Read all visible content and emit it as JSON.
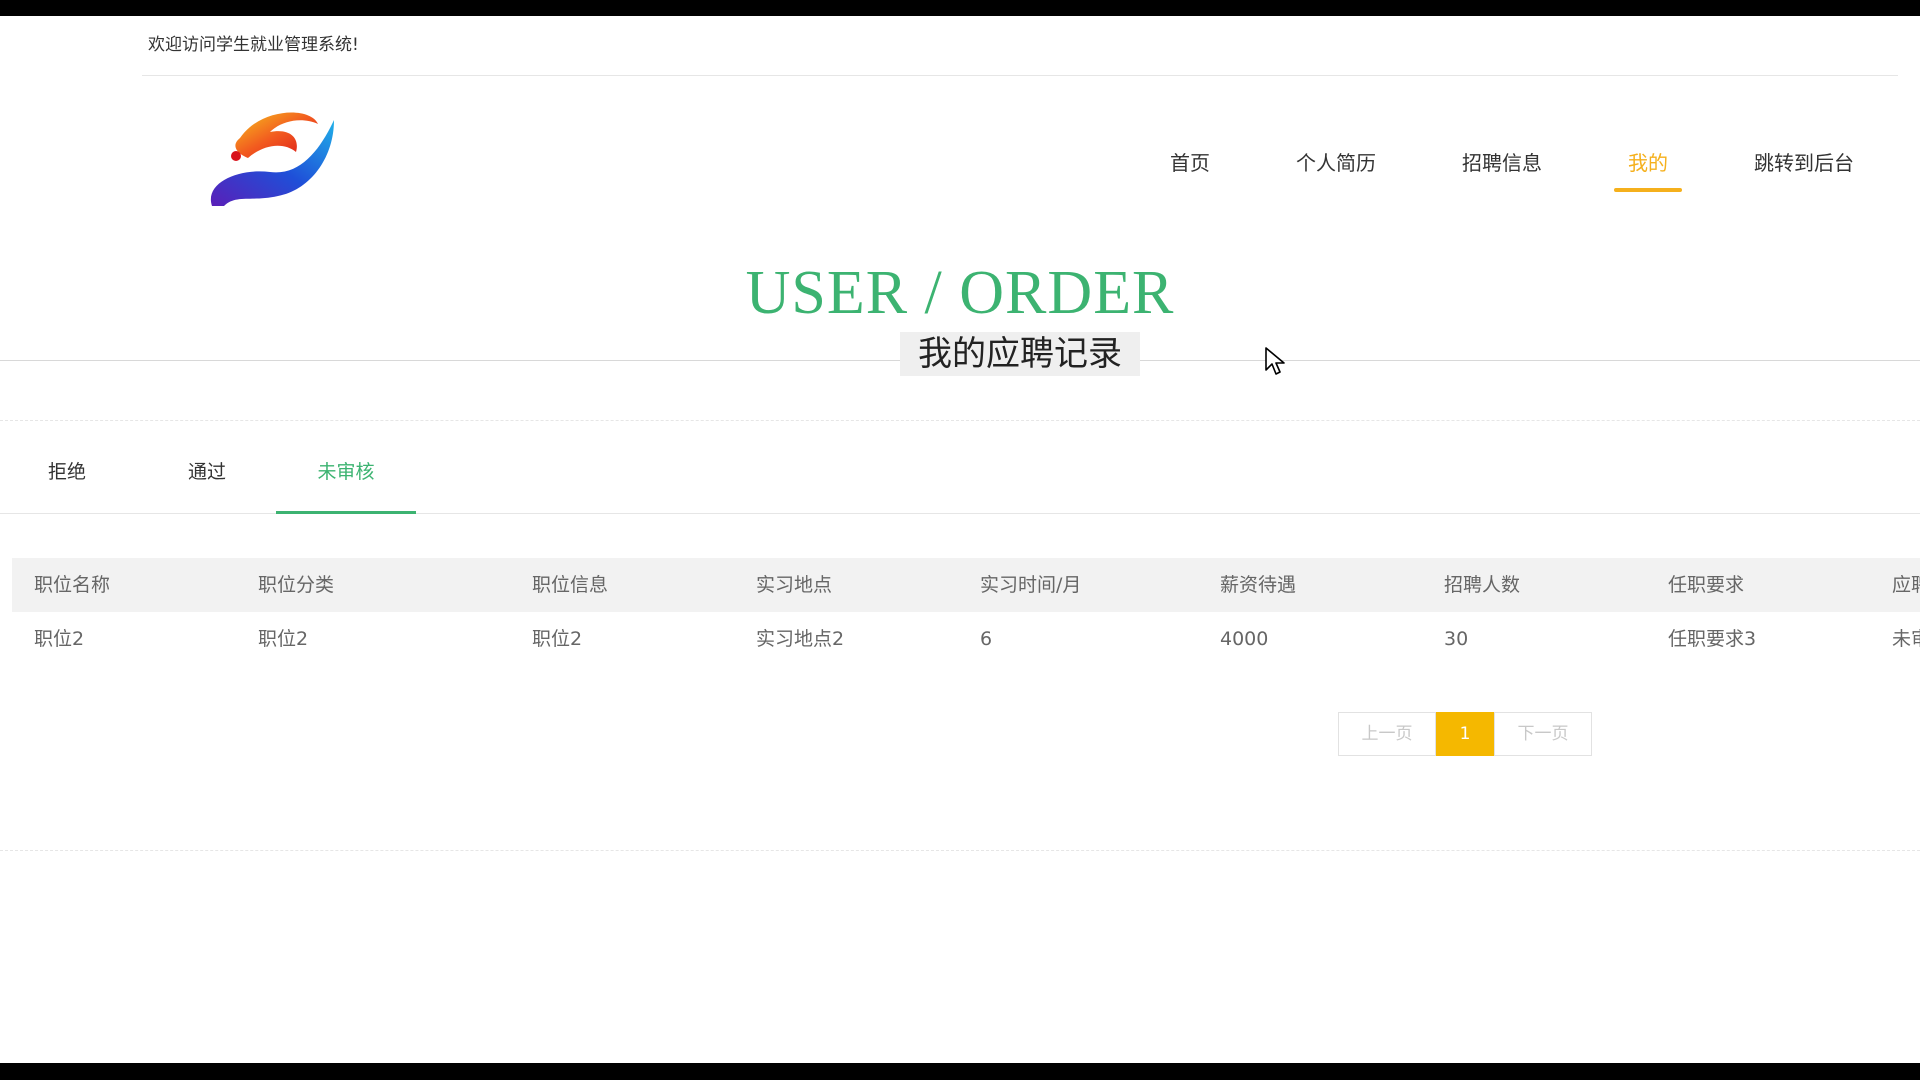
{
  "header": {
    "welcome": "欢迎访问学生就业管理系统!"
  },
  "nav": {
    "items": [
      {
        "label": "首页",
        "active": false
      },
      {
        "label": "个人简历",
        "active": false
      },
      {
        "label": "招聘信息",
        "active": false
      },
      {
        "label": "我的",
        "active": true
      },
      {
        "label": "跳转到后台",
        "active": false
      }
    ]
  },
  "hero": {
    "title": "USER / ORDER",
    "subtitle": "我的应聘记录"
  },
  "tabs": [
    {
      "label": "拒绝",
      "active": false
    },
    {
      "label": "通过",
      "active": false
    },
    {
      "label": "未审核",
      "active": true
    }
  ],
  "table": {
    "columns": [
      "职位名称",
      "职位分类",
      "职位信息",
      "实习地点",
      "实习时间/月",
      "薪资待遇",
      "招聘人数",
      "任职要求",
      "应聘状态"
    ],
    "rows": [
      [
        "职位2",
        "职位2",
        "职位2",
        "实习地点2",
        "6",
        "4000",
        "30",
        "任职要求3",
        "未审核"
      ]
    ]
  },
  "pagination": {
    "prev": "上一页",
    "current": "1",
    "next": "下一页"
  },
  "colors": {
    "accent_green": "#3cb371",
    "accent_yellow": "#f5b01c"
  }
}
